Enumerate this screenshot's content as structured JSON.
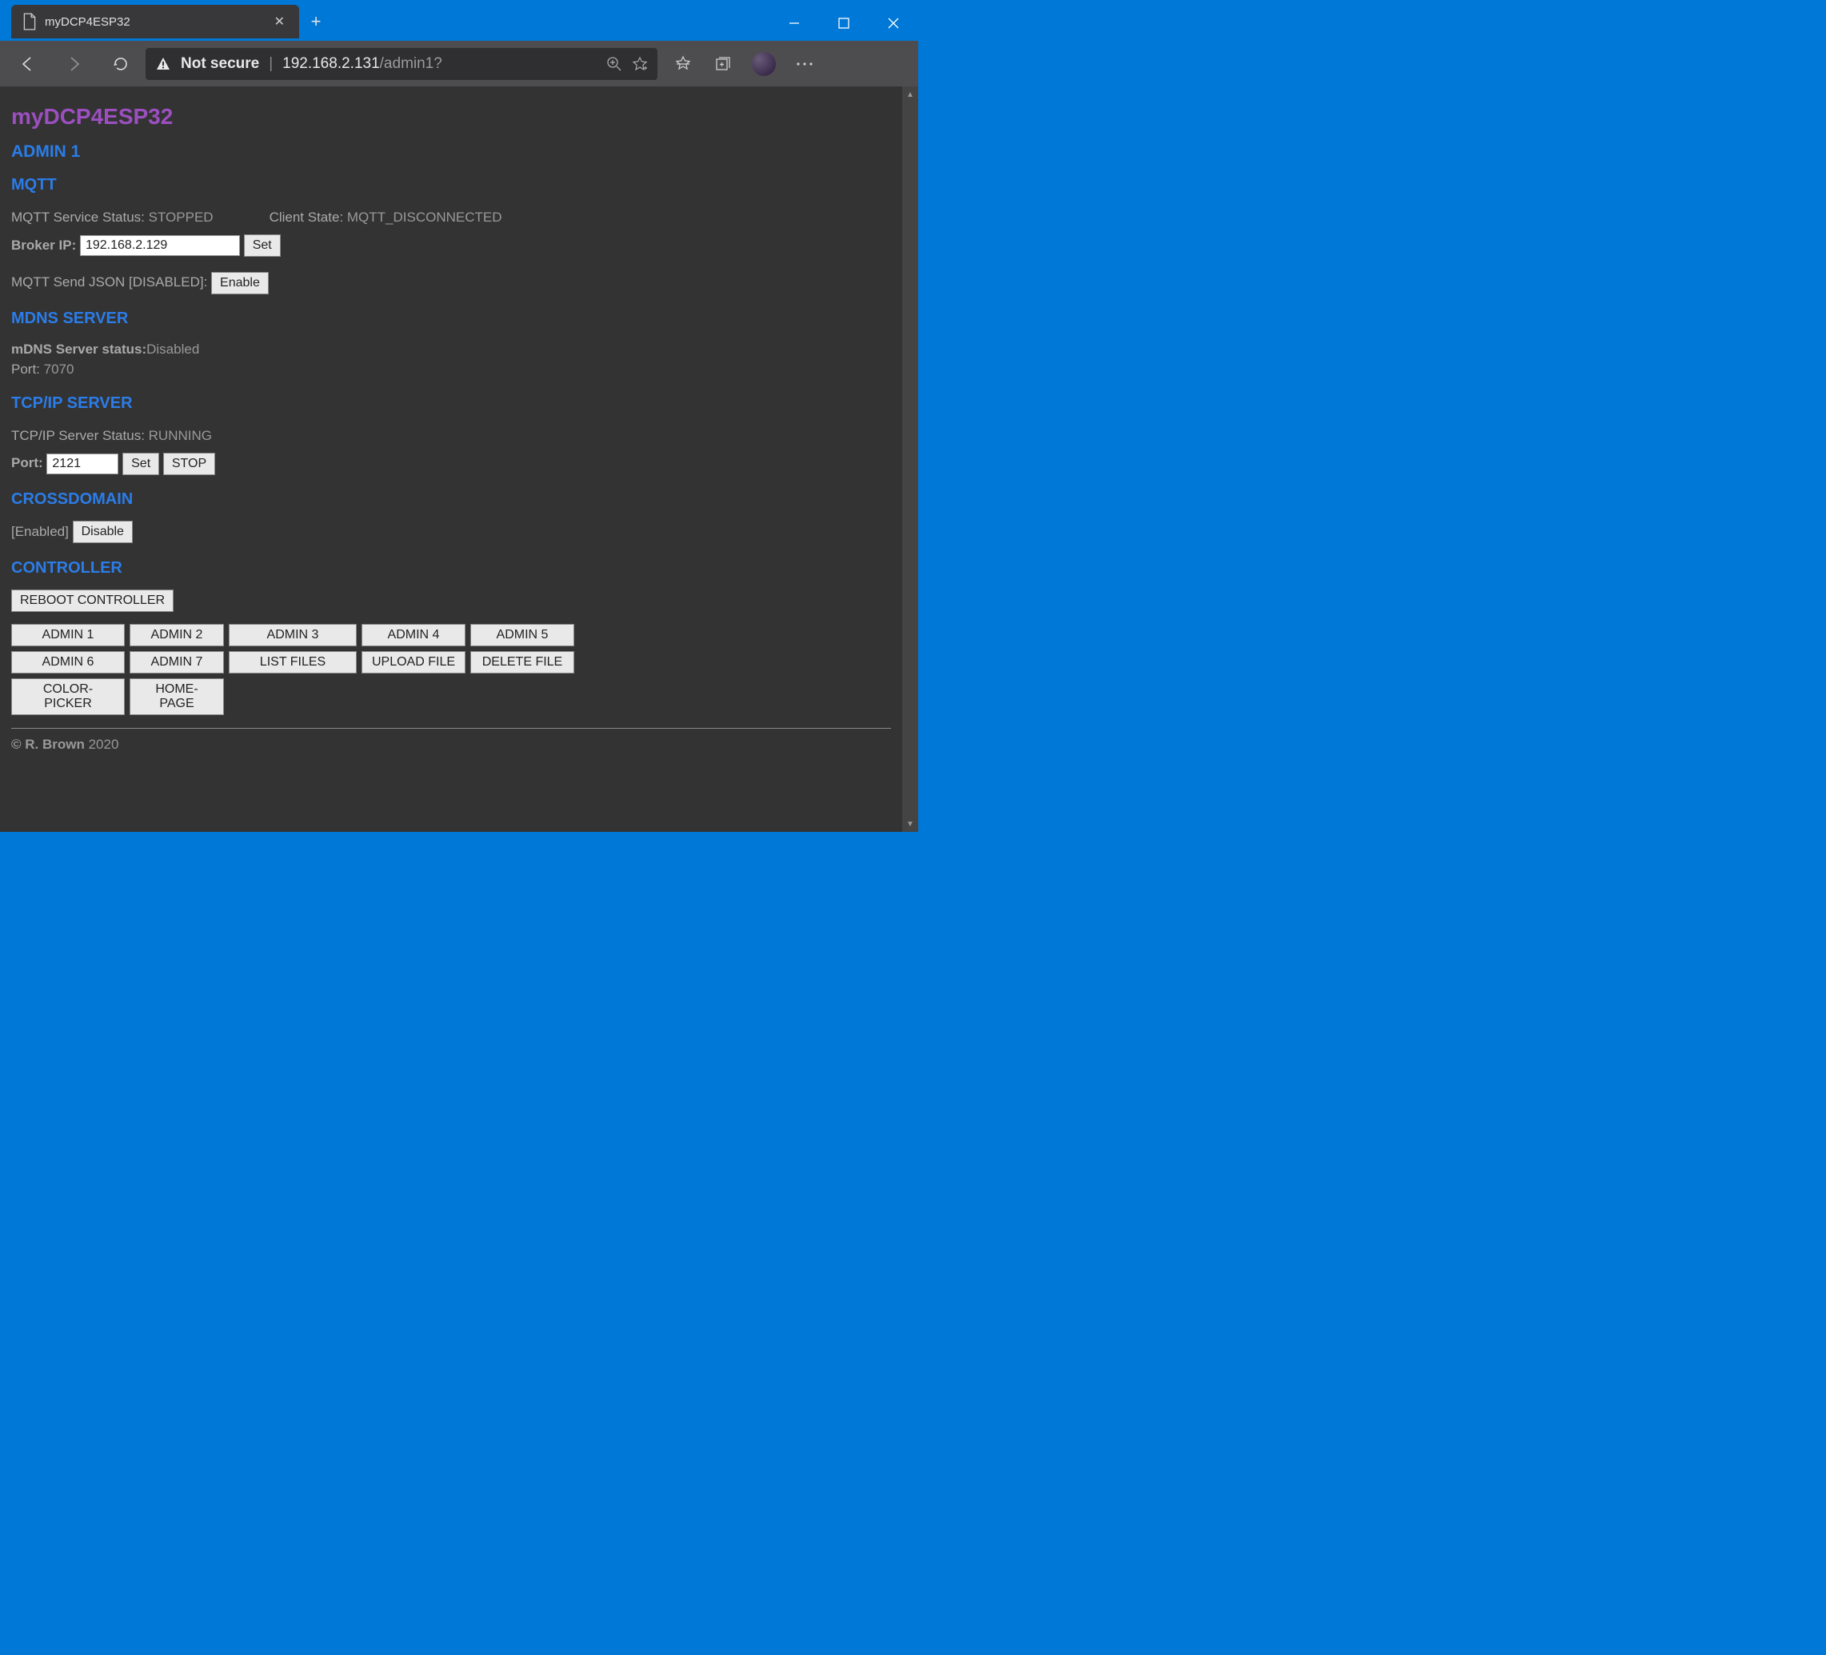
{
  "browser": {
    "tab_title": "myDCP4ESP32",
    "not_secure_label": "Not secure",
    "url_host": "192.168.2.131",
    "url_path": "/admin1?"
  },
  "page": {
    "app_title": "myDCP4ESP32",
    "page_header": "ADMIN 1"
  },
  "mqtt": {
    "heading": "MQTT",
    "service_status_label": "MQTT Service Status: ",
    "service_status_value": "STOPPED",
    "client_state_label": "Client State: ",
    "client_state_value": "MQTT_DISCONNECTED",
    "broker_ip_label": "Broker IP: ",
    "broker_ip_value": "192.168.2.129",
    "set_button": "Set",
    "send_json_label": "MQTT Send JSON [DISABLED]: ",
    "enable_button": "Enable"
  },
  "mdns": {
    "heading": "MDNS SERVER",
    "status_label": "mDNS Server status:",
    "status_value": "Disabled",
    "port_label": "Port: ",
    "port_value": "7070"
  },
  "tcpip": {
    "heading": "TCP/IP SERVER",
    "status_label": "TCP/IP Server Status: ",
    "status_value": "RUNNING",
    "port_label": "Port: ",
    "port_value": "2121",
    "set_button": "Set",
    "stop_button": "STOP"
  },
  "crossdomain": {
    "heading": "CROSSDOMAIN",
    "status": "[Enabled]",
    "disable_button": "Disable"
  },
  "controller": {
    "heading": "CONTROLLER",
    "reboot_button": "REBOOT CONTROLLER"
  },
  "nav": {
    "admin1": "ADMIN 1",
    "admin2": "ADMIN 2",
    "admin3": "ADMIN 3",
    "admin4": "ADMIN 4",
    "admin5": "ADMIN 5",
    "admin6": "ADMIN 6",
    "admin7": "ADMIN 7",
    "listfiles": "LIST FILES",
    "uploadfile": "UPLOAD FILE",
    "deletefile": "DELETE FILE",
    "colorpicker": "COLOR-PICKER",
    "homepage": "HOME-PAGE"
  },
  "footer": {
    "copy": "© R. Brown ",
    "year": "2020"
  }
}
